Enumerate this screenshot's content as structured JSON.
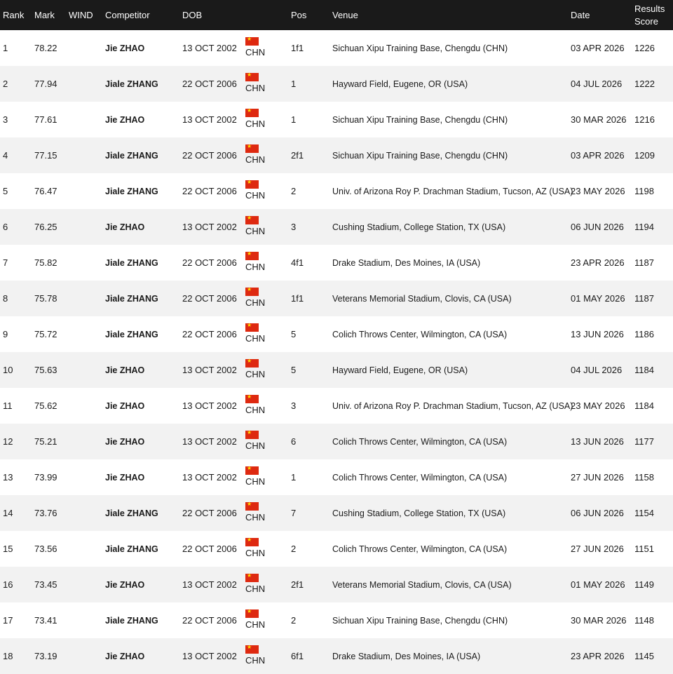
{
  "headers": {
    "rank": "Rank",
    "mark": "Mark",
    "wind": "WIND",
    "competitor": "Competitor",
    "dob": "DOB",
    "pos": "Pos",
    "venue": "Venue",
    "date": "Date",
    "results_score": "Results Score"
  },
  "rows": [
    {
      "rank": "1",
      "mark": "78.22",
      "wind": "",
      "competitor": "Jie ZHAO",
      "dob": "13 OCT 2002",
      "country": "CHN",
      "pos": "1f1",
      "venue": "Sichuan Xipu Training Base, Chengdu (CHN)",
      "date": "03 APR 2026",
      "score": "1226"
    },
    {
      "rank": "2",
      "mark": "77.94",
      "wind": "",
      "competitor": "Jiale ZHANG",
      "dob": "22 OCT 2006",
      "country": "CHN",
      "pos": "1",
      "venue": "Hayward Field, Eugene, OR (USA)",
      "date": "04 JUL 2026",
      "score": "1222"
    },
    {
      "rank": "3",
      "mark": "77.61",
      "wind": "",
      "competitor": "Jie ZHAO",
      "dob": "13 OCT 2002",
      "country": "CHN",
      "pos": "1",
      "venue": "Sichuan Xipu Training Base, Chengdu (CHN)",
      "date": "30 MAR 2026",
      "score": "1216"
    },
    {
      "rank": "4",
      "mark": "77.15",
      "wind": "",
      "competitor": "Jiale ZHANG",
      "dob": "22 OCT 2006",
      "country": "CHN",
      "pos": "2f1",
      "venue": "Sichuan Xipu Training Base, Chengdu (CHN)",
      "date": "03 APR 2026",
      "score": "1209"
    },
    {
      "rank": "5",
      "mark": "76.47",
      "wind": "",
      "competitor": "Jiale ZHANG",
      "dob": "22 OCT 2006",
      "country": "CHN",
      "pos": "2",
      "venue": "Univ. of Arizona Roy P. Drachman Stadium, Tucson, AZ (USA)",
      "date": "23 MAY 2026",
      "score": "1198"
    },
    {
      "rank": "6",
      "mark": "76.25",
      "wind": "",
      "competitor": "Jie ZHAO",
      "dob": "13 OCT 2002",
      "country": "CHN",
      "pos": "3",
      "venue": "Cushing Stadium, College Station, TX (USA)",
      "date": "06 JUN 2026",
      "score": "1194"
    },
    {
      "rank": "7",
      "mark": "75.82",
      "wind": "",
      "competitor": "Jiale ZHANG",
      "dob": "22 OCT 2006",
      "country": "CHN",
      "pos": "4f1",
      "venue": "Drake Stadium, Des Moines, IA (USA)",
      "date": "23 APR 2026",
      "score": "1187"
    },
    {
      "rank": "8",
      "mark": "75.78",
      "wind": "",
      "competitor": "Jiale ZHANG",
      "dob": "22 OCT 2006",
      "country": "CHN",
      "pos": "1f1",
      "venue": "Veterans Memorial Stadium, Clovis, CA (USA)",
      "date": "01 MAY 2026",
      "score": "1187"
    },
    {
      "rank": "9",
      "mark": "75.72",
      "wind": "",
      "competitor": "Jiale ZHANG",
      "dob": "22 OCT 2006",
      "country": "CHN",
      "pos": "5",
      "venue": "Colich Throws Center, Wilmington, CA (USA)",
      "date": "13 JUN 2026",
      "score": "1186"
    },
    {
      "rank": "10",
      "mark": "75.63",
      "wind": "",
      "competitor": "Jie ZHAO",
      "dob": "13 OCT 2002",
      "country": "CHN",
      "pos": "5",
      "venue": "Hayward Field, Eugene, OR (USA)",
      "date": "04 JUL 2026",
      "score": "1184"
    },
    {
      "rank": "11",
      "mark": "75.62",
      "wind": "",
      "competitor": "Jie ZHAO",
      "dob": "13 OCT 2002",
      "country": "CHN",
      "pos": "3",
      "venue": "Univ. of Arizona Roy P. Drachman Stadium, Tucson, AZ (USA)",
      "date": "23 MAY 2026",
      "score": "1184"
    },
    {
      "rank": "12",
      "mark": "75.21",
      "wind": "",
      "competitor": "Jie ZHAO",
      "dob": "13 OCT 2002",
      "country": "CHN",
      "pos": "6",
      "venue": "Colich Throws Center, Wilmington, CA (USA)",
      "date": "13 JUN 2026",
      "score": "1177"
    },
    {
      "rank": "13",
      "mark": "73.99",
      "wind": "",
      "competitor": "Jie ZHAO",
      "dob": "13 OCT 2002",
      "country": "CHN",
      "pos": "1",
      "venue": "Colich Throws Center, Wilmington, CA (USA)",
      "date": "27 JUN 2026",
      "score": "1158"
    },
    {
      "rank": "14",
      "mark": "73.76",
      "wind": "",
      "competitor": "Jiale ZHANG",
      "dob": "22 OCT 2006",
      "country": "CHN",
      "pos": "7",
      "venue": "Cushing Stadium, College Station, TX (USA)",
      "date": "06 JUN 2026",
      "score": "1154"
    },
    {
      "rank": "15",
      "mark": "73.56",
      "wind": "",
      "competitor": "Jiale ZHANG",
      "dob": "22 OCT 2006",
      "country": "CHN",
      "pos": "2",
      "venue": "Colich Throws Center, Wilmington, CA (USA)",
      "date": "27 JUN 2026",
      "score": "1151"
    },
    {
      "rank": "16",
      "mark": "73.45",
      "wind": "",
      "competitor": "Jie ZHAO",
      "dob": "13 OCT 2002",
      "country": "CHN",
      "pos": "2f1",
      "venue": "Veterans Memorial Stadium, Clovis, CA (USA)",
      "date": "01 MAY 2026",
      "score": "1149"
    },
    {
      "rank": "17",
      "mark": "73.41",
      "wind": "",
      "competitor": "Jiale ZHANG",
      "dob": "22 OCT 2006",
      "country": "CHN",
      "pos": "2",
      "venue": "Sichuan Xipu Training Base, Chengdu (CHN)",
      "date": "30 MAR 2026",
      "score": "1148"
    },
    {
      "rank": "18",
      "mark": "73.19",
      "wind": "",
      "competitor": "Jie ZHAO",
      "dob": "13 OCT 2002",
      "country": "CHN",
      "pos": "6f1",
      "venue": "Drake Stadium, Des Moines, IA (USA)",
      "date": "23 APR 2026",
      "score": "1145"
    }
  ],
  "icons": {
    "flag": "china-flag-icon"
  },
  "colors": {
    "header_bg": "#1a1a1a",
    "row_alt_bg": "#f2f2f2",
    "flag_red": "#de2910",
    "flag_star": "#ffde00"
  }
}
